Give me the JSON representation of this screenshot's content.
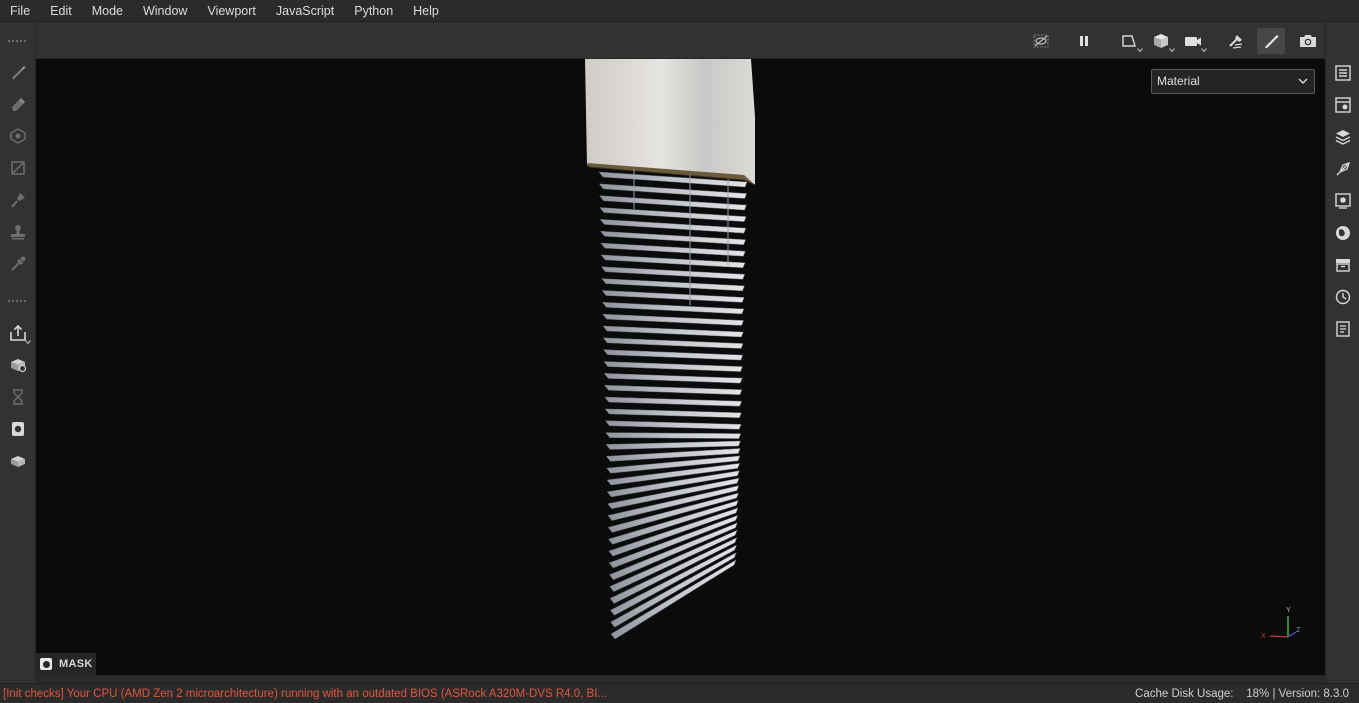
{
  "menu": {
    "items": [
      "File",
      "Edit",
      "Mode",
      "Window",
      "Viewport",
      "JavaScript",
      "Python",
      "Help"
    ]
  },
  "left_toolbar": {
    "tools": [
      "paint-brush-icon",
      "eraser-icon",
      "projection-icon",
      "polygon-fill-icon",
      "smudge-icon",
      "clone-stamp-icon",
      "color-picker-icon"
    ],
    "secondary": [
      "export-icon",
      "bake-icon",
      "hourglass-icon",
      "display-settings-icon",
      "texture-set-icon"
    ]
  },
  "top_toolbar": {
    "tools": [
      "hide-ui-icon",
      "pause-icon",
      "2d-view-icon",
      "3d-view-icon",
      "camera-icon",
      "mesh-mode-icon",
      "paint-mode-icon",
      "screenshot-icon"
    ],
    "active": "paint-mode-icon"
  },
  "right_toolbar": {
    "tools": [
      "layers-list-icon",
      "texture-set-settings-icon",
      "layer-stack-icon",
      "properties-icon",
      "display-icon",
      "environment-icon",
      "shelf-icon",
      "history-icon",
      "log-icon"
    ]
  },
  "viewport": {
    "channel_select": {
      "value": "Material"
    },
    "mask_label": "MASK",
    "axis": {
      "y": "Y",
      "x": "X",
      "z": "Z"
    }
  },
  "status": {
    "message": "[Init checks] Your CPU (AMD Zen 2 microarchitecture) running with an outdated BIOS (ASRock A320M-DVS R4.0, BI...",
    "cache_label": "Cache Disk Usage:",
    "cache_value": "18%",
    "version_label": "Version: 8.3.0",
    "separator": "|"
  },
  "colors": {
    "accent_error": "#e0573e",
    "viewport_bg": "#0b0b0b",
    "panel_bg": "#323232"
  }
}
